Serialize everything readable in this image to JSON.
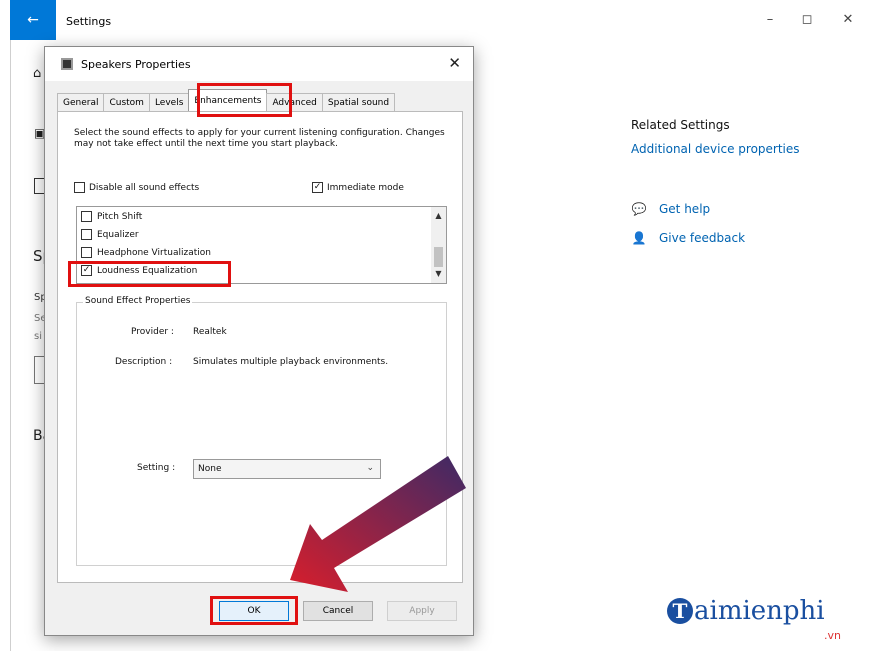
{
  "window": {
    "title": "Settings",
    "back_icon": "back-arrow-icon",
    "controls": {
      "minimize": "–",
      "maximize": "◻",
      "close": "✕"
    }
  },
  "background_fragments": {
    "sp_heading": "Sp",
    "sp_text": "Sp",
    "se_text": "Se",
    "si_text": "si",
    "ba_heading": "Ba"
  },
  "related": {
    "heading": "Related Settings",
    "link": "Additional device properties",
    "help_label": "Get help",
    "feedback_label": "Give feedback"
  },
  "dialog": {
    "title": "Speakers Properties",
    "close": "✕",
    "tabs": [
      {
        "label": "General"
      },
      {
        "label": "Custom"
      },
      {
        "label": "Levels"
      },
      {
        "label": "Enhancements"
      },
      {
        "label": "Advanced"
      },
      {
        "label": "Spatial sound"
      }
    ],
    "active_tab": "Enhancements",
    "description": "Select the sound effects to apply for your current listening configuration. Changes may not take effect until the next time you start playback.",
    "disable_all": {
      "label": "Disable all sound effects",
      "checked": false
    },
    "immediate_mode": {
      "label": "Immediate mode",
      "checked": true
    },
    "effects": [
      {
        "label": "Pitch Shift",
        "checked": false
      },
      {
        "label": "Equalizer",
        "checked": false
      },
      {
        "label": "Headphone Virtualization",
        "checked": false
      },
      {
        "label": "Loudness Equalization",
        "checked": true
      }
    ],
    "properties": {
      "group_label": "Sound Effect Properties",
      "provider_label": "Provider :",
      "provider_value": "Realtek",
      "description_label": "Description :",
      "description_value": "Simulates multiple playback environments.",
      "setting_label": "Setting :",
      "setting_value": "None"
    },
    "buttons": {
      "ok": "OK",
      "cancel": "Cancel",
      "apply": "Apply"
    }
  },
  "brand": {
    "initial": "T",
    "rest": "aimienphi",
    "suffix": ".vn"
  },
  "colors": {
    "accent": "#0078d7",
    "highlight": "#e01010",
    "link": "#0063b1"
  }
}
